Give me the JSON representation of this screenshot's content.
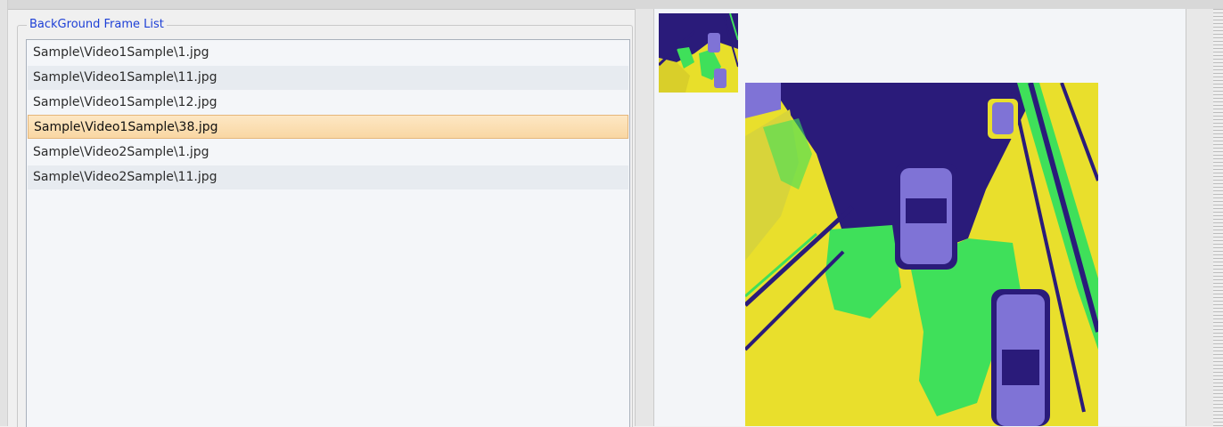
{
  "background_frame_list": {
    "title": "BackGround Frame List",
    "items": [
      {
        "label": "Sample\\Video1Sample\\1.jpg",
        "selected": false
      },
      {
        "label": "Sample\\Video1Sample\\11.jpg",
        "selected": false
      },
      {
        "label": "Sample\\Video1Sample\\12.jpg",
        "selected": false
      },
      {
        "label": "Sample\\Video1Sample\\38.jpg",
        "selected": true
      },
      {
        "label": "Sample\\Video2Sample\\1.jpg",
        "selected": false
      },
      {
        "label": "Sample\\Video2Sample\\11.jpg",
        "selected": false
      }
    ]
  },
  "preview": {
    "thumbnail_label": "frame-thumbnail",
    "image_label": "background-frame-preview",
    "palette": {
      "yellow": "#e8df2a",
      "green": "#3fe05a",
      "dark_blue": "#2a1b7a",
      "violet": "#7f73d6"
    }
  },
  "colors": {
    "group_title": "#1d3fd6",
    "selection": "#f9d7a3"
  }
}
